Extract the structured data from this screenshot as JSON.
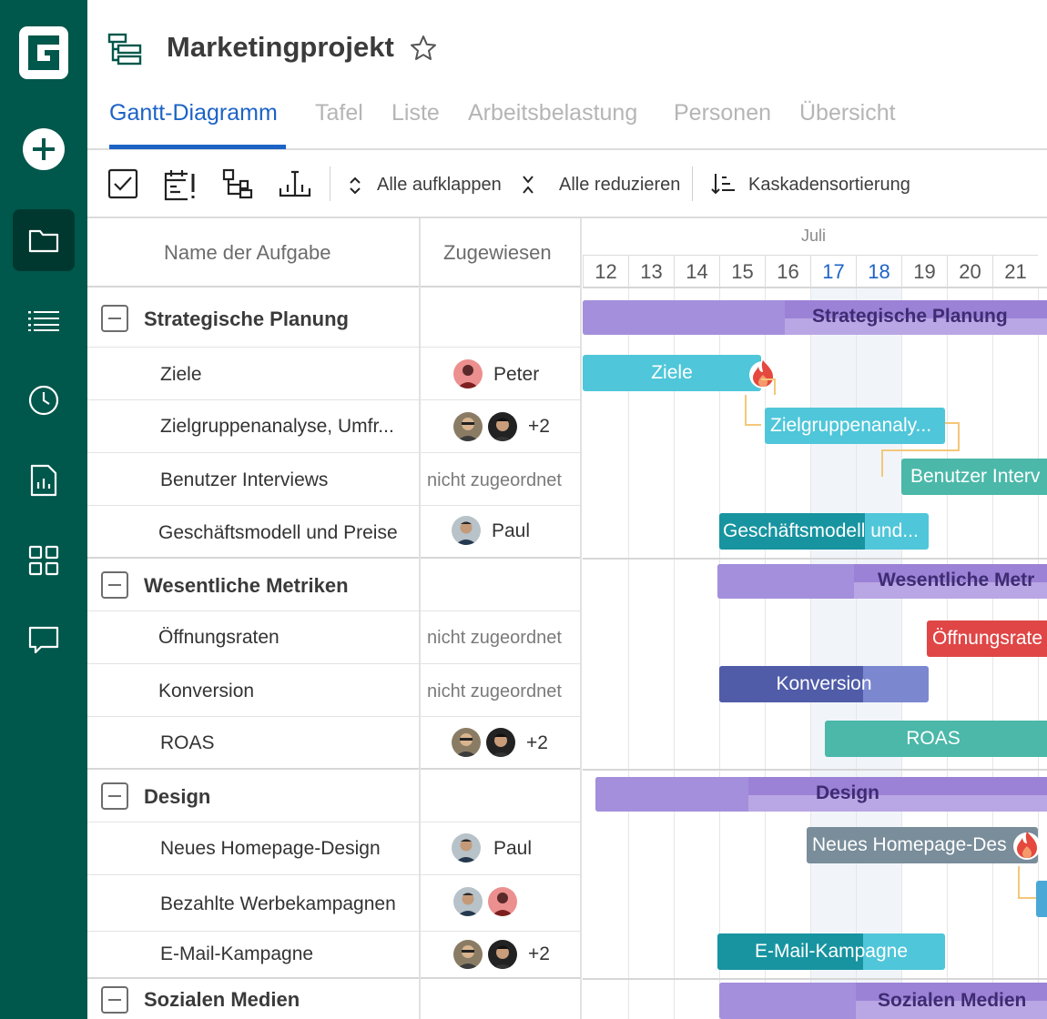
{
  "sidebar": {
    "logo": "G",
    "items": [
      {
        "icon": "plus-circle-icon"
      },
      {
        "icon": "folder-icon",
        "active": true
      },
      {
        "icon": "list-icon"
      },
      {
        "icon": "clock-icon"
      },
      {
        "icon": "report-icon"
      },
      {
        "icon": "grid-icon"
      },
      {
        "icon": "chat-icon"
      }
    ]
  },
  "header": {
    "title": "Marketingprojekt",
    "tabs": [
      "Gantt-Diagramm",
      "Tafel",
      "Liste",
      "Arbeitsbelastung",
      "Personen",
      "Übersicht"
    ],
    "active_tab": "Gantt-Diagramm"
  },
  "toolbar": {
    "expand_all": "Alle aufklappen",
    "collapse_all": "Alle reduzieren",
    "cascade_sort": "Kaskadensortierung"
  },
  "grid": {
    "col_task": "Name der Aufgabe",
    "col_assigned": "Zugewiesen",
    "rows": [
      {
        "type": "group",
        "name": "Strategische Planung"
      },
      {
        "type": "task",
        "name": "Ziele",
        "assignee": "Peter"
      },
      {
        "type": "task",
        "name": "Zielgruppenanalyse, Umfr...",
        "assignee": "+2"
      },
      {
        "type": "task",
        "name": "Benutzer Interviews",
        "assignee": "nicht zugeordnet"
      },
      {
        "type": "task",
        "name": "Geschäftsmodell und Preise",
        "assignee": "Paul"
      },
      {
        "type": "group",
        "name": "Wesentliche Metriken"
      },
      {
        "type": "task",
        "name": "Öffnungsraten",
        "assignee": "nicht zugeordnet"
      },
      {
        "type": "task",
        "name": "Konversion",
        "assignee": "nicht zugeordnet"
      },
      {
        "type": "task",
        "name": "ROAS",
        "assignee": "+2"
      },
      {
        "type": "group",
        "name": "Design"
      },
      {
        "type": "task",
        "name": "Neues Homepage-Design",
        "assignee": "Paul"
      },
      {
        "type": "task",
        "name": "Bezahlte Werbekampagnen",
        "assignee": ""
      },
      {
        "type": "task",
        "name": "E-Mail-Kampagne",
        "assignee": "+2"
      },
      {
        "type": "group",
        "name": "Sozialen Medien"
      }
    ]
  },
  "timeline": {
    "month": "Juli",
    "days": [
      "12",
      "13",
      "14",
      "15",
      "16",
      "17",
      "18",
      "19",
      "20",
      "21"
    ],
    "highlight_days": [
      "17",
      "18"
    ],
    "bars": [
      {
        "label": "Strategische Planung",
        "kind": "group"
      },
      {
        "label": "Ziele",
        "kind": "task"
      },
      {
        "label": "Zielgruppenanaly...",
        "kind": "task"
      },
      {
        "label": "Benutzer Interv",
        "kind": "task"
      },
      {
        "label": "Geschäftsmodell und...",
        "kind": "task"
      },
      {
        "label": "Wesentliche Metr",
        "kind": "group"
      },
      {
        "label": "Öffnungsrate",
        "kind": "task"
      },
      {
        "label": "Konversion",
        "kind": "task"
      },
      {
        "label": "ROAS",
        "kind": "task"
      },
      {
        "label": "Design",
        "kind": "group"
      },
      {
        "label": "Neues Homepage-Des",
        "kind": "task"
      },
      {
        "label": "E-Mail-Kampagne",
        "kind": "task"
      },
      {
        "label": "Sozialen Medien",
        "kind": "group"
      }
    ]
  },
  "colors": {
    "sidebar": "#00574b",
    "accent": "#1c63c5",
    "group_bar": "#9c82d6",
    "teal": "#4fc6d9",
    "red": "#e04646",
    "indigo": "#505ca8",
    "green": "#4bb8a9",
    "slate": "#798d9a"
  }
}
